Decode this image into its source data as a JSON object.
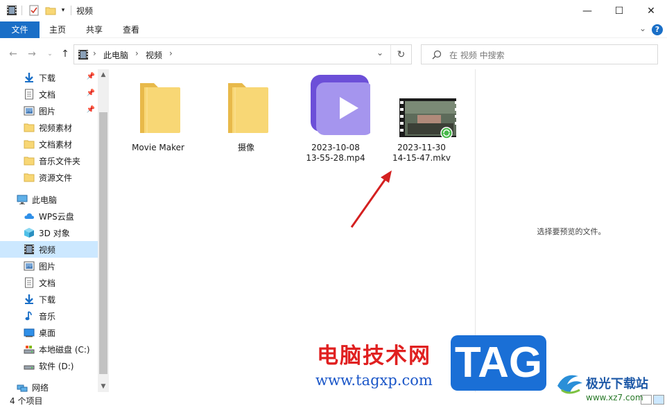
{
  "window": {
    "title": "视频",
    "controls": {
      "minimize": "—",
      "maximize": "☐",
      "close": "✕"
    }
  },
  "ribbon": {
    "tabs": [
      "文件",
      "主页",
      "共享",
      "查看"
    ],
    "help": "?",
    "file_tab_color": "#1a6fc7"
  },
  "address": {
    "crumbs": [
      "此电脑",
      "视频"
    ],
    "separator": "›"
  },
  "search": {
    "placeholder": "在 视频 中搜索"
  },
  "sidebar": {
    "quick_access": [
      {
        "label": "下载",
        "icon": "download-icon",
        "pinned": true
      },
      {
        "label": "文档",
        "icon": "document-icon",
        "pinned": true
      },
      {
        "label": "图片",
        "icon": "picture-icon",
        "pinned": true
      },
      {
        "label": "视频素材",
        "icon": "folder-icon",
        "pinned": false
      },
      {
        "label": "文档素材",
        "icon": "folder-icon",
        "pinned": false
      },
      {
        "label": "音乐文件夹",
        "icon": "folder-icon",
        "pinned": false
      },
      {
        "label": "资源文件",
        "icon": "folder-icon",
        "pinned": false
      }
    ],
    "this_pc": {
      "label": "此电脑",
      "items": [
        {
          "label": "WPS云盘",
          "icon": "cloud-icon"
        },
        {
          "label": "3D 对象",
          "icon": "cube-icon"
        },
        {
          "label": "视频",
          "icon": "video-icon",
          "selected": true
        },
        {
          "label": "图片",
          "icon": "picture-icon"
        },
        {
          "label": "文档",
          "icon": "document-icon"
        },
        {
          "label": "下载",
          "icon": "download-icon"
        },
        {
          "label": "音乐",
          "icon": "music-icon"
        },
        {
          "label": "桌面",
          "icon": "desktop-icon"
        },
        {
          "label": "本地磁盘 (C:)",
          "icon": "drive-icon"
        },
        {
          "label": "软件 (D:)",
          "icon": "drive-icon"
        }
      ]
    },
    "network": {
      "label": "网络",
      "icon": "network-icon"
    }
  },
  "files": [
    {
      "name": "Movie Maker",
      "type": "folder"
    },
    {
      "name": "摄像",
      "type": "folder"
    },
    {
      "name": "2023-10-08\n13-55-28.mp4",
      "line1": "2023-10-08",
      "line2": "13-55-28.mp4",
      "type": "mp4"
    },
    {
      "name": "2023-11-30\n14-15-47.mkv",
      "line1": "2023-11-30",
      "line2": "14-15-47.mkv",
      "type": "mkv"
    }
  ],
  "preview": {
    "message": "选择要预览的文件。"
  },
  "status": {
    "count": "4 个项目"
  },
  "watermark": {
    "cn": "电脑技术网",
    "url": "www.tagxp.com",
    "tag": "TAG",
    "site": "极光下载站",
    "site_url": "www.xz7.com"
  },
  "colors": {
    "selection": "#cce8ff",
    "accent": "#1a6fc7",
    "folder": "#f8d775",
    "arrow": "#d42020"
  }
}
